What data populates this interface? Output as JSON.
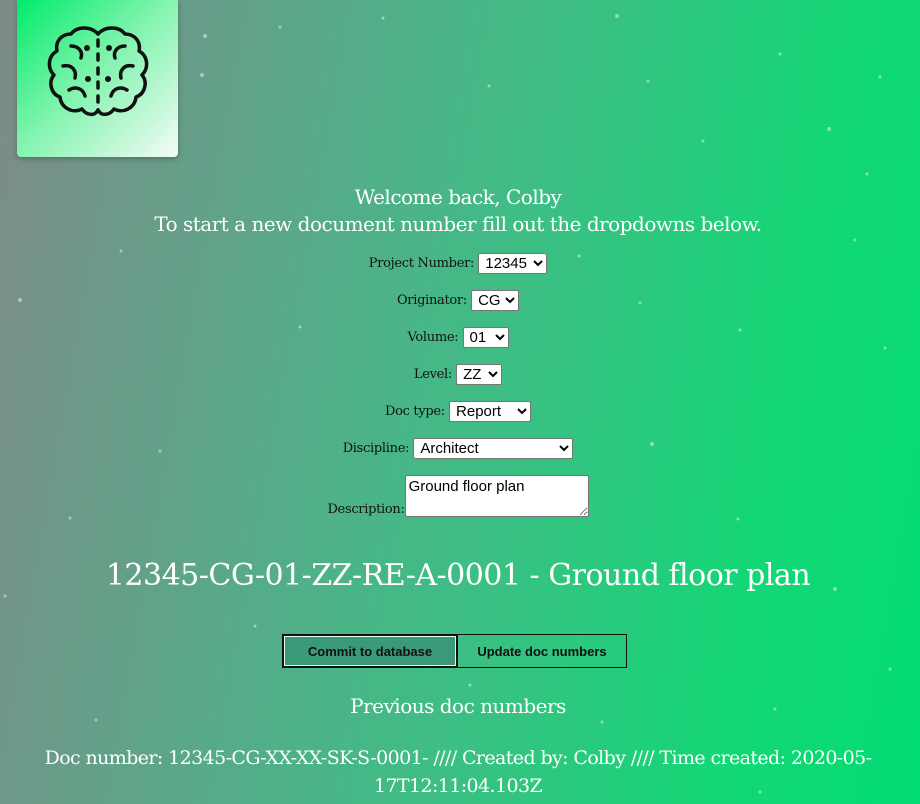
{
  "logo": {
    "icon": "brain-icon",
    "colors": {
      "from": "#00ec6a",
      "to": "#f4fbf6"
    }
  },
  "welcome": {
    "line1": "Welcome back, Colby",
    "line2": "To start a new document number fill out the dropdowns below."
  },
  "form": {
    "project_number": {
      "label": "Project Number:",
      "value": "12345"
    },
    "originator": {
      "label": "Originator:",
      "value": "CG"
    },
    "volume": {
      "label": "Volume:",
      "value": "01"
    },
    "level": {
      "label": "Level:",
      "value": "ZZ"
    },
    "doc_type": {
      "label": "Doc type:",
      "value": "Report"
    },
    "discipline": {
      "label": "Discipline:",
      "value": "Architect"
    },
    "description": {
      "label": "Description:",
      "value": "Ground floor plan"
    }
  },
  "generated_doc_number": "12345-CG-01-ZZ-RE-A-0001 - Ground floor plan",
  "buttons": {
    "commit": "Commit to database",
    "update": "Update doc numbers"
  },
  "previous": {
    "title": "Previous doc numbers",
    "entries": [
      "Doc number: 12345-CG-XX-XX-SK-S-0001- //// Created by: Colby //// Time created: 2020-05-17T12:11:04.103Z"
    ]
  },
  "colors": {
    "bg_left": "#7e8b88",
    "bg_right": "#02dc74",
    "commit_button": "#3a9a77"
  }
}
